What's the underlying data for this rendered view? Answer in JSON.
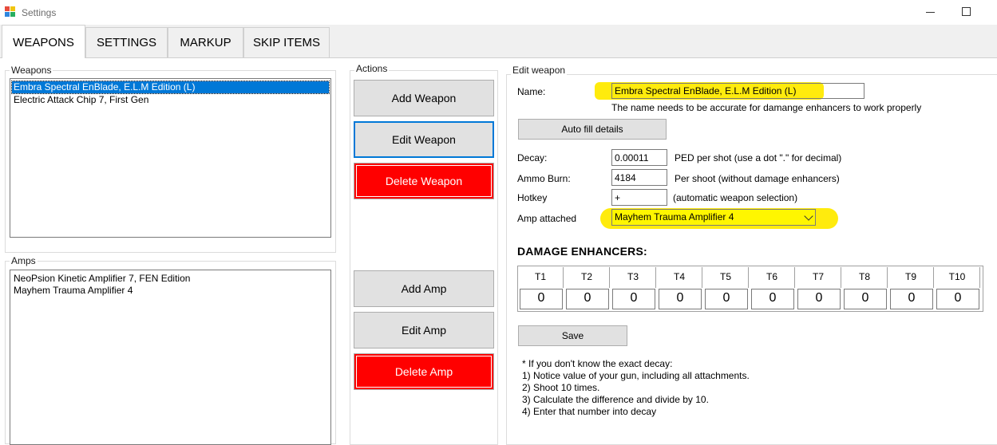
{
  "window": {
    "title": "Settings"
  },
  "tabs": [
    {
      "label": "WEAPONS",
      "active": true
    },
    {
      "label": "SETTINGS",
      "active": false
    },
    {
      "label": "MARKUP",
      "active": false
    },
    {
      "label": "SKIP ITEMS",
      "active": false
    }
  ],
  "weapons_group": {
    "label": "Weapons",
    "items": [
      {
        "text": "Embra Spectral EnBlade, E.L.M Edition (L)",
        "selected": true
      },
      {
        "text": "Electric Attack Chip 7, First Gen",
        "selected": false
      }
    ]
  },
  "amps_group": {
    "label": "Amps",
    "items": [
      {
        "text": "NeoPsion Kinetic Amplifier 7, FEN Edition"
      },
      {
        "text": "Mayhem Trauma Amplifier 4"
      }
    ]
  },
  "actions": {
    "label": "Actions",
    "add_weapon": "Add Weapon",
    "edit_weapon": "Edit Weapon",
    "delete_weapon": "Delete Weapon",
    "add_amp": "Add Amp",
    "edit_amp": "Edit Amp",
    "delete_amp": "Delete Amp"
  },
  "edit_weapon": {
    "label": "Edit weapon",
    "name_label": "Name:",
    "name_value": "Embra Spectral EnBlade, E.L.M Edition (L)",
    "name_hint": "The name needs to be accurate for damange enhancers to work properly",
    "autofill_button": "Auto fill details",
    "decay_label": "Decay:",
    "decay_value": "0.00011",
    "decay_hint": "PED per shot (use a dot \".\" for decimal)",
    "ammo_label": "Ammo Burn:",
    "ammo_value": "4184",
    "ammo_hint": "Per shoot (without damage enhancers)",
    "hotkey_label": "Hotkey",
    "hotkey_value": "+",
    "hotkey_hint": "(automatic weapon selection)",
    "amp_label": "Amp attached",
    "amp_value": "Mayhem Trauma Amplifier 4",
    "de_title": "DAMAGE ENHANCERS:",
    "de_headers": [
      "T1",
      "T2",
      "T3",
      "T4",
      "T5",
      "T6",
      "T7",
      "T8",
      "T9",
      "T10"
    ],
    "de_values": [
      "0",
      "0",
      "0",
      "0",
      "0",
      "0",
      "0",
      "0",
      "0",
      "0"
    ],
    "save_button": "Save",
    "notes": [
      "* If you don't know the exact decay:",
      "1) Notice value of your gun, including all attachments.",
      "2) Shoot 10 times.",
      "3) Calculate the difference and divide by 10.",
      "4) Enter that number into decay"
    ]
  },
  "colors": {
    "selection": "#0078d7",
    "delete_button": "#ff0000",
    "highlight": "#ffea00"
  }
}
